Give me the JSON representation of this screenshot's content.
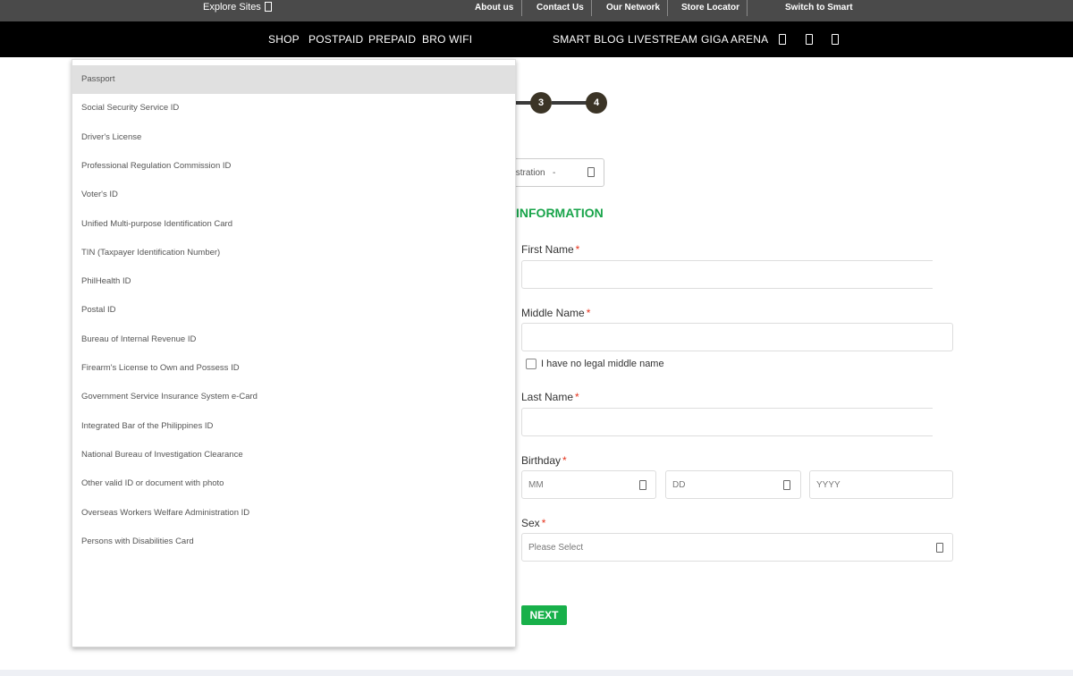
{
  "topbar": {
    "explore_label": "Explore Sites",
    "links": [
      "About us",
      "Contact Us",
      "Our Network",
      "Store Locator",
      "Switch to Smart"
    ]
  },
  "mainnav": {
    "left_items": [
      "SHOP",
      "POSTPAID",
      "PREPAID",
      "BRO WIFI"
    ],
    "right_items": [
      "SMART BLOG",
      "LIVESTREAM",
      "GIGA ARENA"
    ],
    "icons": [
      "user-icon",
      "cart-icon",
      "search-icon"
    ]
  },
  "stepper": {
    "steps": [
      "3",
      "4"
    ]
  },
  "registration": {
    "value": "gistration",
    "suffix": "-"
  },
  "section": {
    "title": "INFORMATION"
  },
  "form": {
    "first_name_label": "First Name",
    "middle_name_label": "Middle Name",
    "no_middle_name_label": "I have no legal middle name",
    "last_name_label": "Last Name",
    "birthday_label": "Birthday",
    "birthday_mm": "MM",
    "birthday_dd": "DD",
    "birthday_yyyy": "YYYY",
    "sex_label": "Sex",
    "sex_placeholder": "Please Select",
    "required_mark": "*",
    "next_label": "NEXT"
  },
  "dropdown": {
    "selected": "Passport",
    "options": [
      "Passport",
      "Social Security Service ID",
      "Driver's License",
      "Professional Regulation Commission ID",
      "Voter's ID",
      "Unified Multi-purpose Identification Card",
      "TIN (Taxpayer Identification Number)",
      "PhilHealth ID",
      "Postal ID",
      "Bureau of Internal Revenue ID",
      "Firearm's License to Own and Possess ID",
      "Government Service Insurance System e-Card",
      "Integrated Bar of the Philippines ID",
      "National Bureau of Investigation Clearance",
      "Other valid ID or document with photo",
      "Overseas Workers Welfare Administration ID",
      "Persons with Disabilities Card"
    ]
  },
  "colors": {
    "accent_green": "#18b04a",
    "section_green": "#18a44a",
    "required_red": "#e5341d",
    "step_dark": "#3b3426"
  }
}
